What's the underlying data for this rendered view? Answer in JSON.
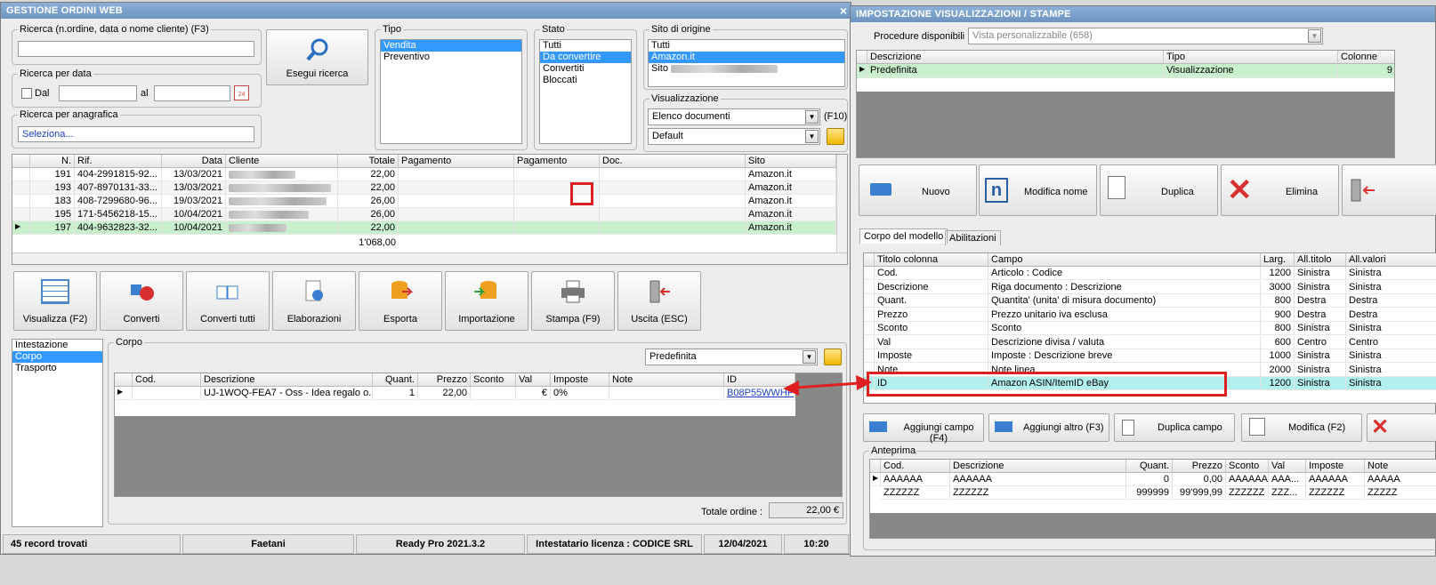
{
  "left_window": {
    "title": "GESTIONE ORDINI WEB",
    "close": "×",
    "search": {
      "legend": "Ricerca (n.ordine, data o nome cliente) (F3)",
      "value": "",
      "button": "Esegui ricerca"
    },
    "date_search": {
      "legend": "Ricerca per data",
      "from_label": "Dal",
      "to_label": "al",
      "from_value": "",
      "to_value": "",
      "cal_icon": "24"
    },
    "anagrafica": {
      "legend": "Ricerca per anagrafica",
      "value": "Seleziona..."
    },
    "tipo": {
      "legend": "Tipo",
      "items": [
        "Vendita",
        "Preventivo"
      ],
      "selected": 0
    },
    "stato": {
      "legend": "Stato",
      "items": [
        "Tutti",
        "Da convertire",
        "Convertiti",
        "Bloccati"
      ],
      "selected": 1
    },
    "sito": {
      "legend": "Sito di origine",
      "items": [
        "Tutti",
        "Amazon.it",
        "Sito"
      ],
      "selected": 1
    },
    "visualizzazione": {
      "legend": "Visualizzazione",
      "view": "Elenco documenti",
      "shortcut": "(F10)",
      "preset": "Default"
    },
    "orders": {
      "headers": [
        "N.",
        "Rif.",
        "Data",
        "Cliente",
        "Totale",
        "Pagamento",
        "Pagamento",
        "Doc.",
        "Sito"
      ],
      "rows": [
        {
          "n": "191",
          "rif": "404-2991815-92...",
          "data": "13/03/2021",
          "totale": "22,00",
          "sito": "Amazon.it"
        },
        {
          "n": "193",
          "rif": "407-8970131-33...",
          "data": "13/03/2021",
          "totale": "22,00",
          "sito": "Amazon.it"
        },
        {
          "n": "183",
          "rif": "408-7299680-96...",
          "data": "19/03/2021",
          "totale": "26,00",
          "sito": "Amazon.it"
        },
        {
          "n": "195",
          "rif": "171-5456218-15...",
          "data": "10/04/2021",
          "totale": "26,00",
          "sito": "Amazon.it"
        },
        {
          "n": "197",
          "rif": "404-9632823-32...",
          "data": "10/04/2021",
          "totale": "22,00",
          "sito": "Amazon.it"
        }
      ],
      "total": "1'068,00"
    },
    "toolbar": [
      "Visualizza (F2)",
      "Converti",
      "Converti tutti",
      "Elaborazioni",
      "Esporta",
      "Importazione",
      "Stampa (F9)",
      "Uscita (ESC)"
    ],
    "sections": {
      "items": [
        "Intestazione",
        "Corpo",
        "Trasporto"
      ],
      "selected": 1
    },
    "corpo": {
      "legend": "Corpo",
      "preset": "Predefinita",
      "headers": [
        "Cod.",
        "Descrizione",
        "Quant.",
        "Prezzo",
        "Sconto",
        "Val",
        "Imposte",
        "Note",
        "ID"
      ],
      "row": {
        "cod": "",
        "descrizione": "UJ-1WOQ-FEA7 - Oss - Idea regalo o...",
        "quant": "1",
        "prezzo": "22,00",
        "sconto": "",
        "val": "€",
        "imposte": "0%",
        "note": "",
        "id": "B08P55WWHP"
      },
      "total_label": "Totale ordine :",
      "total_value": "22,00 €"
    },
    "statusbar": {
      "records": "45 record trovati",
      "user": "Faetani",
      "version": "Ready Pro 2021.3.2",
      "license": "Intestatario licenza : CODICE SRL",
      "date": "12/04/2021",
      "time": "10:20"
    }
  },
  "right_window": {
    "title": "IMPOSTAZIONE VISUALIZZAZIONI / STAMPE",
    "procedure_label": "Procedure disponibili :",
    "procedure_value": "Vista personalizzabile (658)",
    "models": {
      "headers": [
        "Descrizione",
        "Tipo",
        "Colonne"
      ],
      "rows": [
        {
          "descrizione": "Predefinita",
          "tipo": "Visualizzazione",
          "colonne": "9"
        }
      ]
    },
    "buttons": [
      "Nuovo",
      "Modifica nome",
      "Duplica",
      "Elimina"
    ],
    "tabs": [
      "Corpo del modello",
      "Abilitazioni"
    ],
    "fields": {
      "headers": [
        "Titolo colonna",
        "Campo",
        "Larg.",
        "All.titolo",
        "All.valori"
      ],
      "rows": [
        [
          "Cod.",
          "Articolo : Codice",
          "1200",
          "Sinistra",
          "Sinistra"
        ],
        [
          "Descrizione",
          "Riga documento : Descrizione",
          "3000",
          "Sinistra",
          "Sinistra"
        ],
        [
          "Quant.",
          "Quantita' (unita' di misura documento)",
          "800",
          "Destra",
          "Destra"
        ],
        [
          "Prezzo",
          "Prezzo unitario iva esclusa",
          "900",
          "Destra",
          "Destra"
        ],
        [
          "Sconto",
          "Sconto",
          "800",
          "Sinistra",
          "Sinistra"
        ],
        [
          "Val",
          "Descrizione divisa / valuta",
          "600",
          "Centro",
          "Centro"
        ],
        [
          "Imposte",
          "Imposte : Descrizione breve",
          "1000",
          "Sinistra",
          "Sinistra"
        ],
        [
          "Note",
          "Note linea",
          "2000",
          "Sinistra",
          "Sinistra"
        ],
        [
          "ID",
          "Amazon ASIN/ItemID eBay",
          "1200",
          "Sinistra",
          "Sinistra"
        ]
      ]
    },
    "field_buttons": [
      "Aggiungi campo (F4)",
      "Aggiungi altro (F3)",
      "Duplica campo",
      "Modifica (F2)"
    ],
    "preview": {
      "legend": "Anteprima",
      "headers": [
        "Cod.",
        "Descrizione",
        "Quant.",
        "Prezzo",
        "Sconto",
        "Val",
        "Imposte",
        "Note"
      ],
      "rows": [
        [
          "AAAAAA",
          "AAAAAA",
          "0",
          "0,00",
          "AAAAAA",
          "AAA...",
          "AAAAAA",
          "AAAAA"
        ],
        [
          "ZZZZZZ",
          "ZZZZZZ",
          "999999",
          "99'999,99",
          "ZZZZZZ",
          "ZZZ...",
          "ZZZZZZ",
          "ZZZZZ"
        ]
      ]
    }
  },
  "colors": {
    "title_bar": "#7aa0cc",
    "selection": "#3399ff",
    "selected_row": "#c9f0cc",
    "highlight_row": "#b2f0ee",
    "annotation": "#e02020"
  }
}
